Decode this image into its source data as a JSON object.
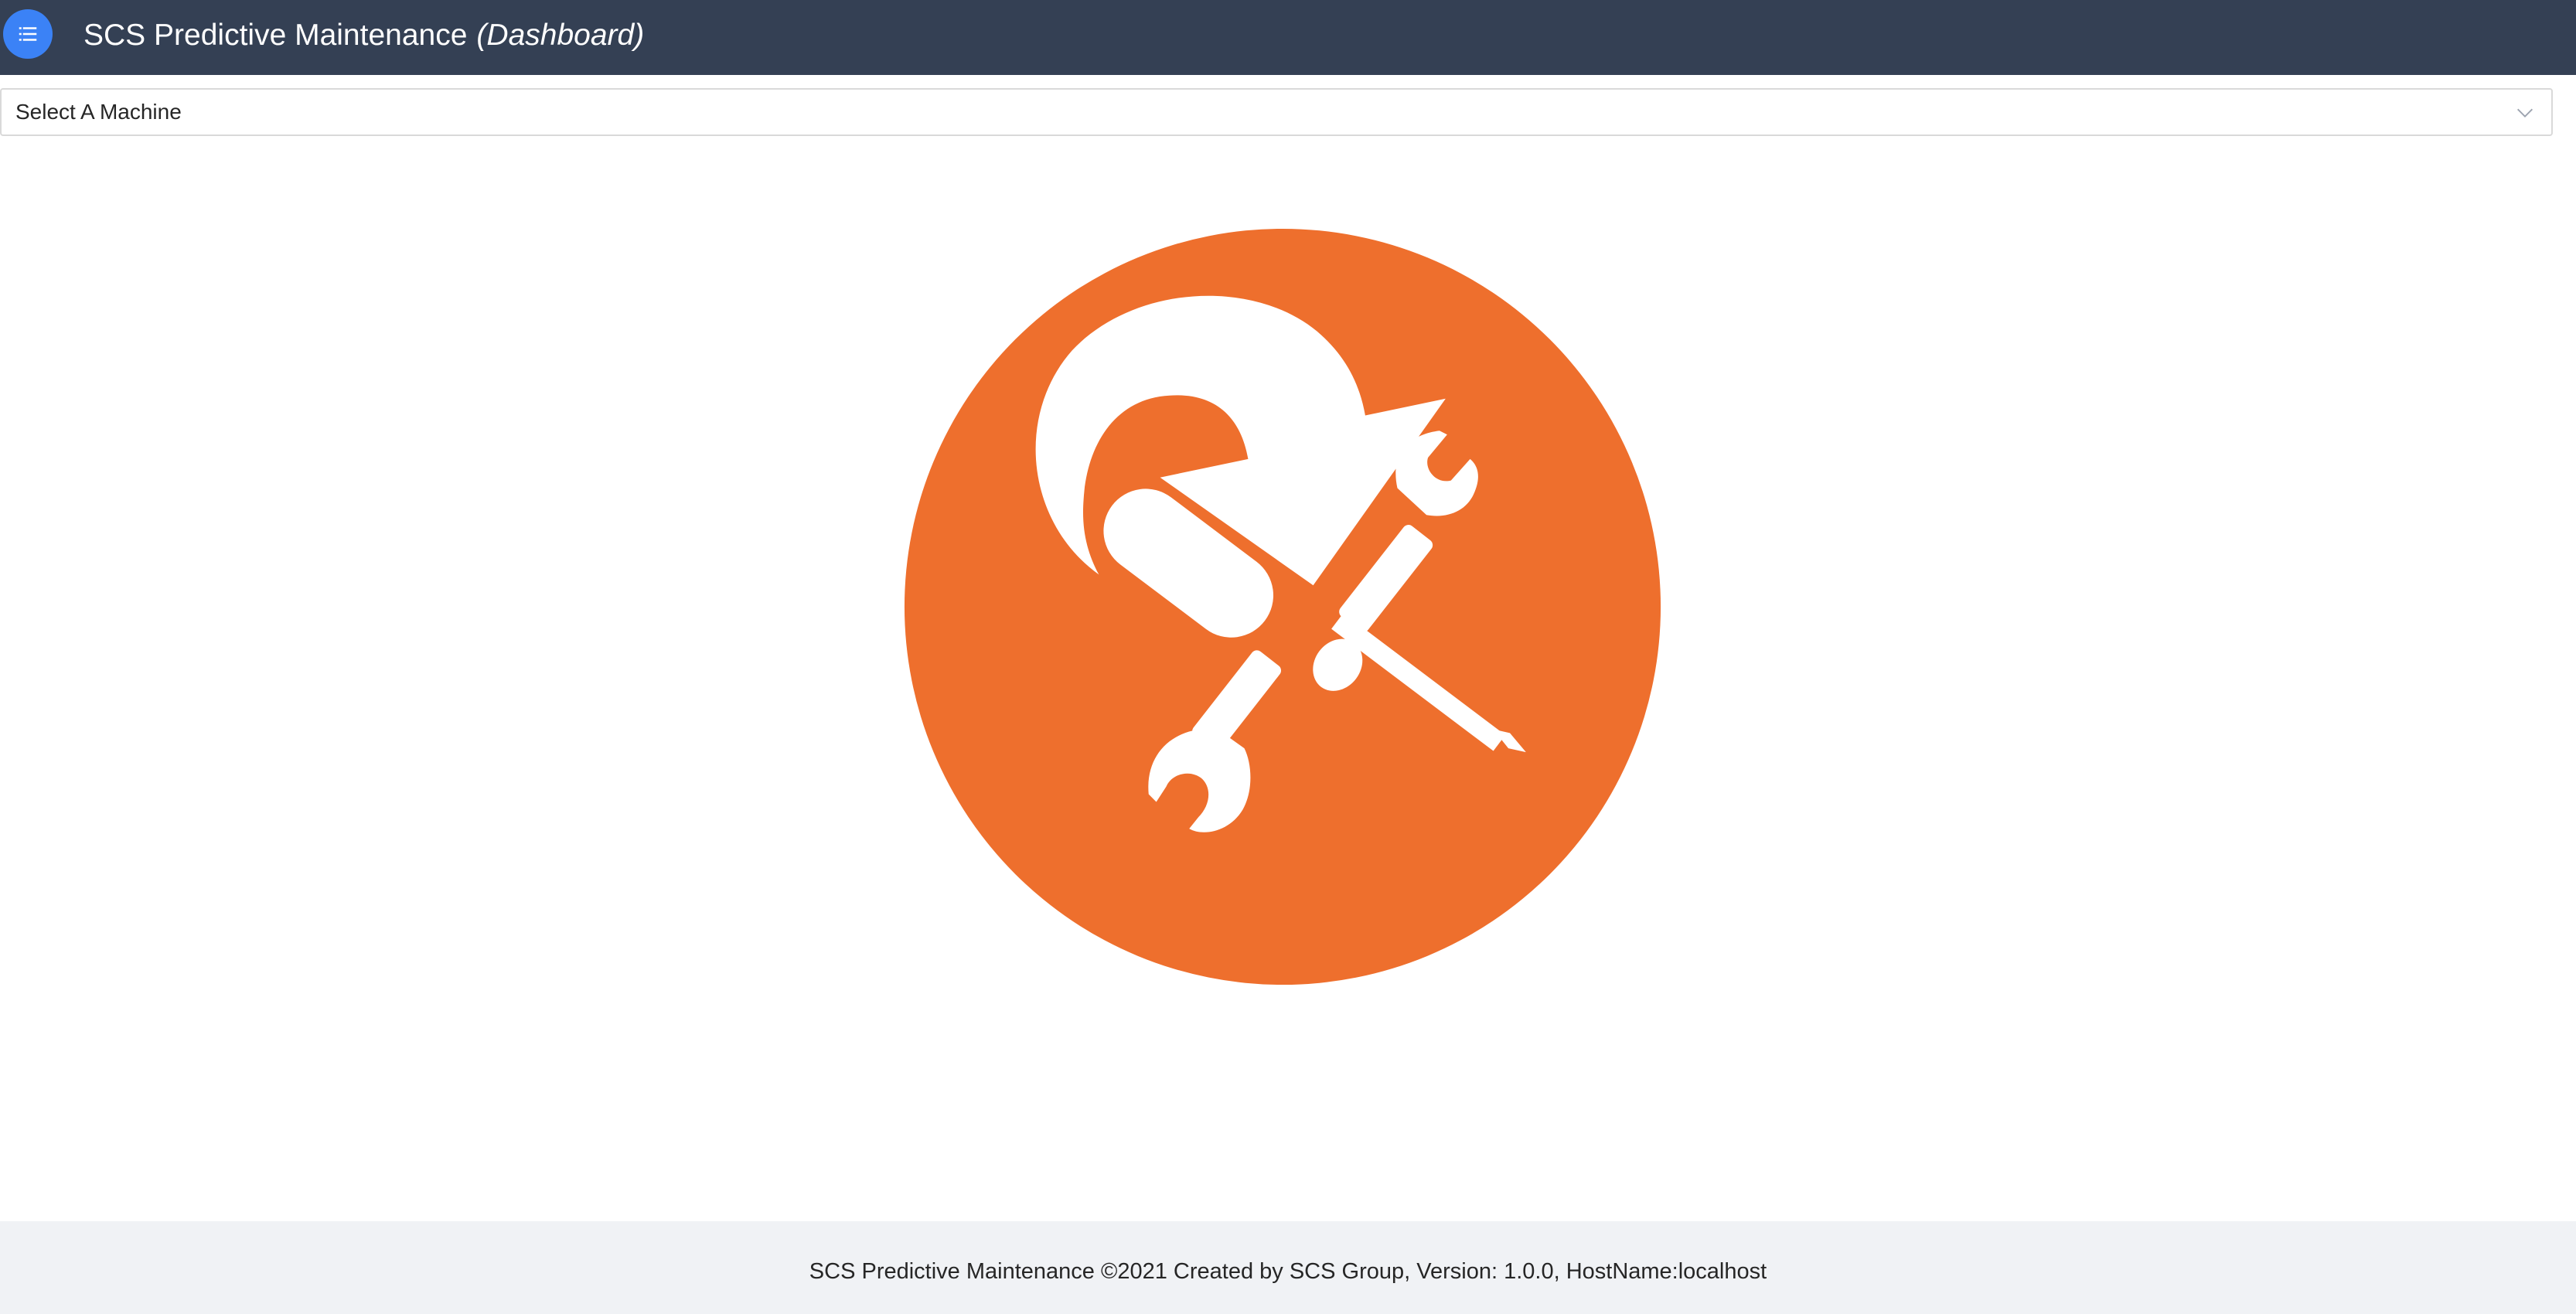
{
  "header": {
    "menu_icon": "list-icon",
    "title": "SCS Predictive Maintenance",
    "subtitle": "(Dashboard)",
    "background": "#344054",
    "menu_button_color": "#3b82f6"
  },
  "machine_select": {
    "selected": "Select A Machine",
    "icon": "chevron-down-icon"
  },
  "logo": {
    "icon": "maintenance-tools-icon",
    "color": "#ee6f2d"
  },
  "footer": {
    "text": "SCS Predictive Maintenance ©2021 Created by SCS Group, Version: 1.0.0, HostName:localhost"
  }
}
